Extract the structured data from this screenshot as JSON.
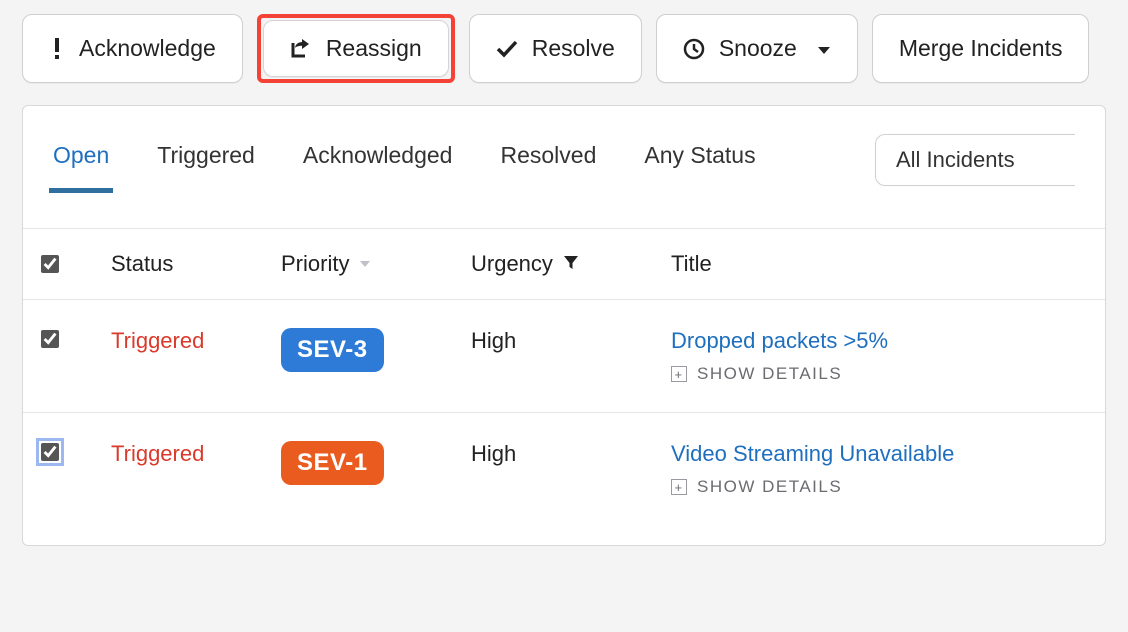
{
  "toolbar": {
    "acknowledge": "Acknowledge",
    "reassign": "Reassign",
    "resolve": "Resolve",
    "snooze": "Snooze",
    "merge": "Merge Incidents"
  },
  "tabs": {
    "open": "Open",
    "triggered": "Triggered",
    "acknowledged": "Acknowledged",
    "resolved": "Resolved",
    "any": "Any Status"
  },
  "filter": {
    "selected": "All Incidents"
  },
  "columns": {
    "status": "Status",
    "priority": "Priority",
    "urgency": "Urgency",
    "title": "Title"
  },
  "details_label": "SHOW DETAILS",
  "rows": [
    {
      "status": "Triggered",
      "priority": "SEV-3",
      "priority_color": "blue",
      "urgency": "High",
      "title": "Dropped packets >5%"
    },
    {
      "status": "Triggered",
      "priority": "SEV-1",
      "priority_color": "orange",
      "urgency": "High",
      "title": "Video Streaming Unavailable"
    }
  ]
}
